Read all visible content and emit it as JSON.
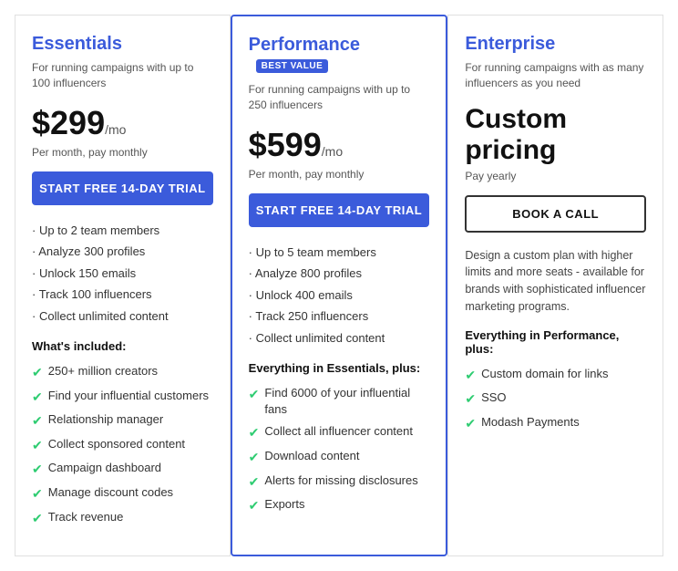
{
  "plans": [
    {
      "id": "essentials",
      "name": "Essentials",
      "badge": null,
      "subtitle": "For running campaigns with up to 100 influencers",
      "price": "$299",
      "price_unit": "/mo",
      "price_note": "Per month, pay monthly",
      "cta_label": "START FREE 14-DAY TRIAL",
      "cta_style": "filled",
      "featured": false,
      "bullet_features": [
        "Up to 2 team members",
        "Analyze 300 profiles",
        "Unlock 150 emails",
        "Track 100 influencers",
        "Collect unlimited content"
      ],
      "included_label": "What's included:",
      "check_features": [
        "250+ million creators",
        "Find your influential customers",
        "Relationship manager",
        "Collect sponsored content",
        "Campaign dashboard",
        "Manage discount codes",
        "Track revenue"
      ],
      "enterprise_desc": null,
      "everything_label": null,
      "enterprise_check": null
    },
    {
      "id": "performance",
      "name": "Performance",
      "badge": "BEST VALUE",
      "subtitle": "For running campaigns with up to 250 influencers",
      "price": "$599",
      "price_unit": "/mo",
      "price_note": "Per month, pay monthly",
      "cta_label": "START FREE 14-DAY TRIAL",
      "cta_style": "filled",
      "featured": true,
      "bullet_features": [
        "Up to 5 team members",
        "Analyze 800 profiles",
        "Unlock 400 emails",
        "Track 250 influencers",
        "Collect unlimited content"
      ],
      "included_label": "Everything in Essentials, plus:",
      "check_features": [
        "Find 6000 of your influential fans",
        "Collect all influencer content",
        "Download content",
        "Alerts for missing disclosures",
        "Exports"
      ],
      "enterprise_desc": null,
      "everything_label": null,
      "enterprise_check": null
    },
    {
      "id": "enterprise",
      "name": "Enterprise",
      "badge": null,
      "subtitle": "For running campaigns with as many influencers as you need",
      "custom_price": "Custom pricing",
      "price_note": "Pay yearly",
      "cta_label": "BOOK A CALL",
      "cta_style": "outline",
      "featured": false,
      "bullet_features": null,
      "included_label": null,
      "check_features": null,
      "enterprise_desc": "Design a custom plan with higher limits and more seats - available for brands with sophisticated influencer marketing programs.",
      "everything_label": "Everything in Performance, plus:",
      "enterprise_check": [
        "Custom domain for links",
        "SSO",
        "Modash Payments"
      ]
    }
  ]
}
